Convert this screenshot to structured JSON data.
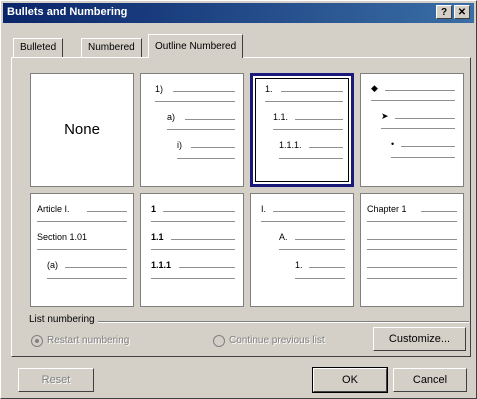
{
  "window": {
    "title": "Bullets and Numbering",
    "help_label": "?",
    "close_label": "✕"
  },
  "tabs": [
    {
      "label": "Bulleted",
      "active": false
    },
    {
      "label": "Numbered",
      "active": false
    },
    {
      "label": "Outline Numbered",
      "active": true
    }
  ],
  "gallery": {
    "none_label": "None",
    "cell2": [
      "1)",
      "a)",
      "i)"
    ],
    "cell3": [
      "1.",
      "1.1.",
      "1.1.1."
    ],
    "cell4": [
      "◆",
      "➤",
      "•"
    ],
    "cell5": [
      "Article I.",
      "Section 1.01",
      "(a)"
    ],
    "cell6": [
      "1",
      "1.1",
      "1.1.1"
    ],
    "cell7": [
      "I.",
      "A.",
      "1."
    ],
    "cell8": [
      "Chapter 1"
    ]
  },
  "list_numbering": {
    "group_label": "List numbering",
    "restart_label": "Restart numbering",
    "continue_label": "Continue previous list"
  },
  "buttons": {
    "customize": "Customize...",
    "reset": "Reset",
    "ok": "OK",
    "cancel": "Cancel"
  }
}
